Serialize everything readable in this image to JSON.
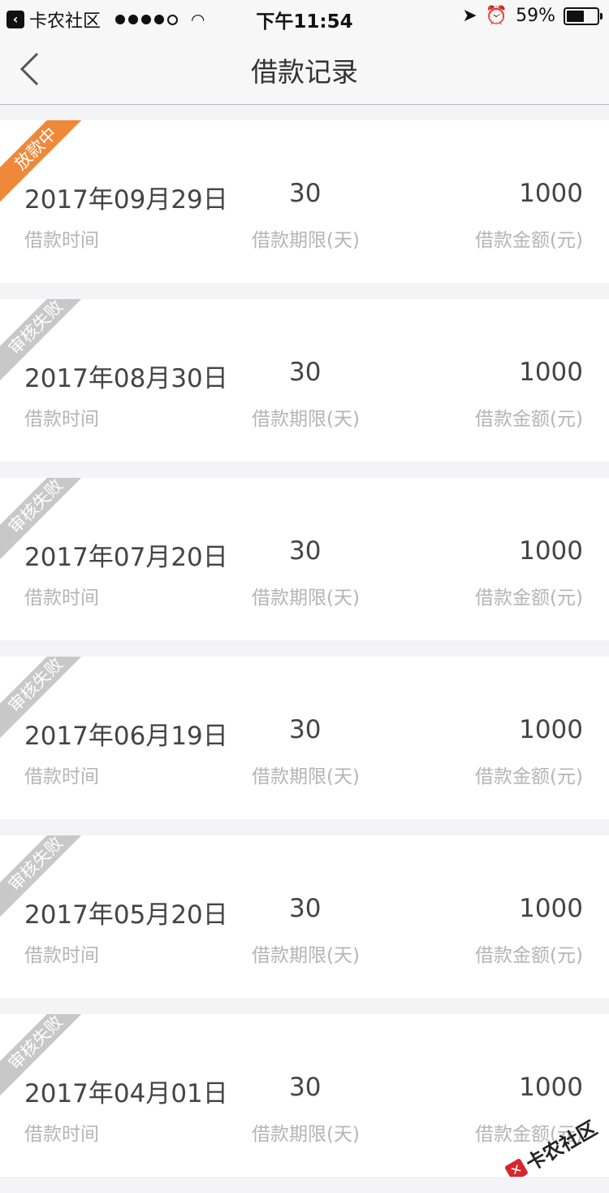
{
  "status_bar": {
    "back_app": "卡农社区",
    "time": "下午11:54",
    "battery": "59%",
    "battery_level": 0.59
  },
  "nav": {
    "title": "借款记录"
  },
  "labels": {
    "date": "借款时间",
    "term": "借款期限(天)",
    "amount": "借款金额(元)"
  },
  "records": [
    {
      "status": "放款中",
      "date": "2017年09月29日",
      "term": "30",
      "amount": "1000"
    },
    {
      "status": "审核失败",
      "date": "2017年08月30日",
      "term": "30",
      "amount": "1000"
    },
    {
      "status": "审核失败",
      "date": "2017年07月20日",
      "term": "30",
      "amount": "1000"
    },
    {
      "status": "审核失败",
      "date": "2017年06月19日",
      "term": "30",
      "amount": "1000"
    },
    {
      "status": "审核失败",
      "date": "2017年05月20日",
      "term": "30",
      "amount": "1000"
    },
    {
      "status": "审核失败",
      "date": "2017年04月01日",
      "term": "30",
      "amount": "1000"
    }
  ],
  "watermark": "卡农社区",
  "colors": {
    "ribbon_active": "#f0883a",
    "ribbon_failed": "#c8c8c8"
  }
}
